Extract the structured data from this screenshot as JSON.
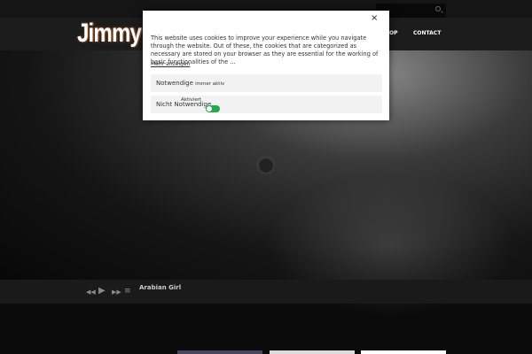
{
  "header": {
    "search_placeholder": "",
    "logo": "Jimmy",
    "nav": [
      "OP",
      "CONTACT"
    ]
  },
  "player": {
    "track": "Arabian Girl",
    "icons": [
      "prev-icon",
      "play-icon",
      "next-icon",
      "playlist-icon"
    ]
  },
  "cookie": {
    "close": "×",
    "message": "This website uses cookies to improve your experience while you navigate through the website. Out of these, the cookies that are categorized as necessary are stored on your browser as they are essential for the working of basic functionalities of the ...",
    "more": "Mehr anzeigen",
    "necessary": {
      "label": "Notwendige",
      "status": "immer aktiv"
    },
    "non_necessary": {
      "label": "Nicht Notwendige",
      "toggle_label": "Aktiviert",
      "enabled": true
    },
    "toggle_color": "#22a94e"
  }
}
